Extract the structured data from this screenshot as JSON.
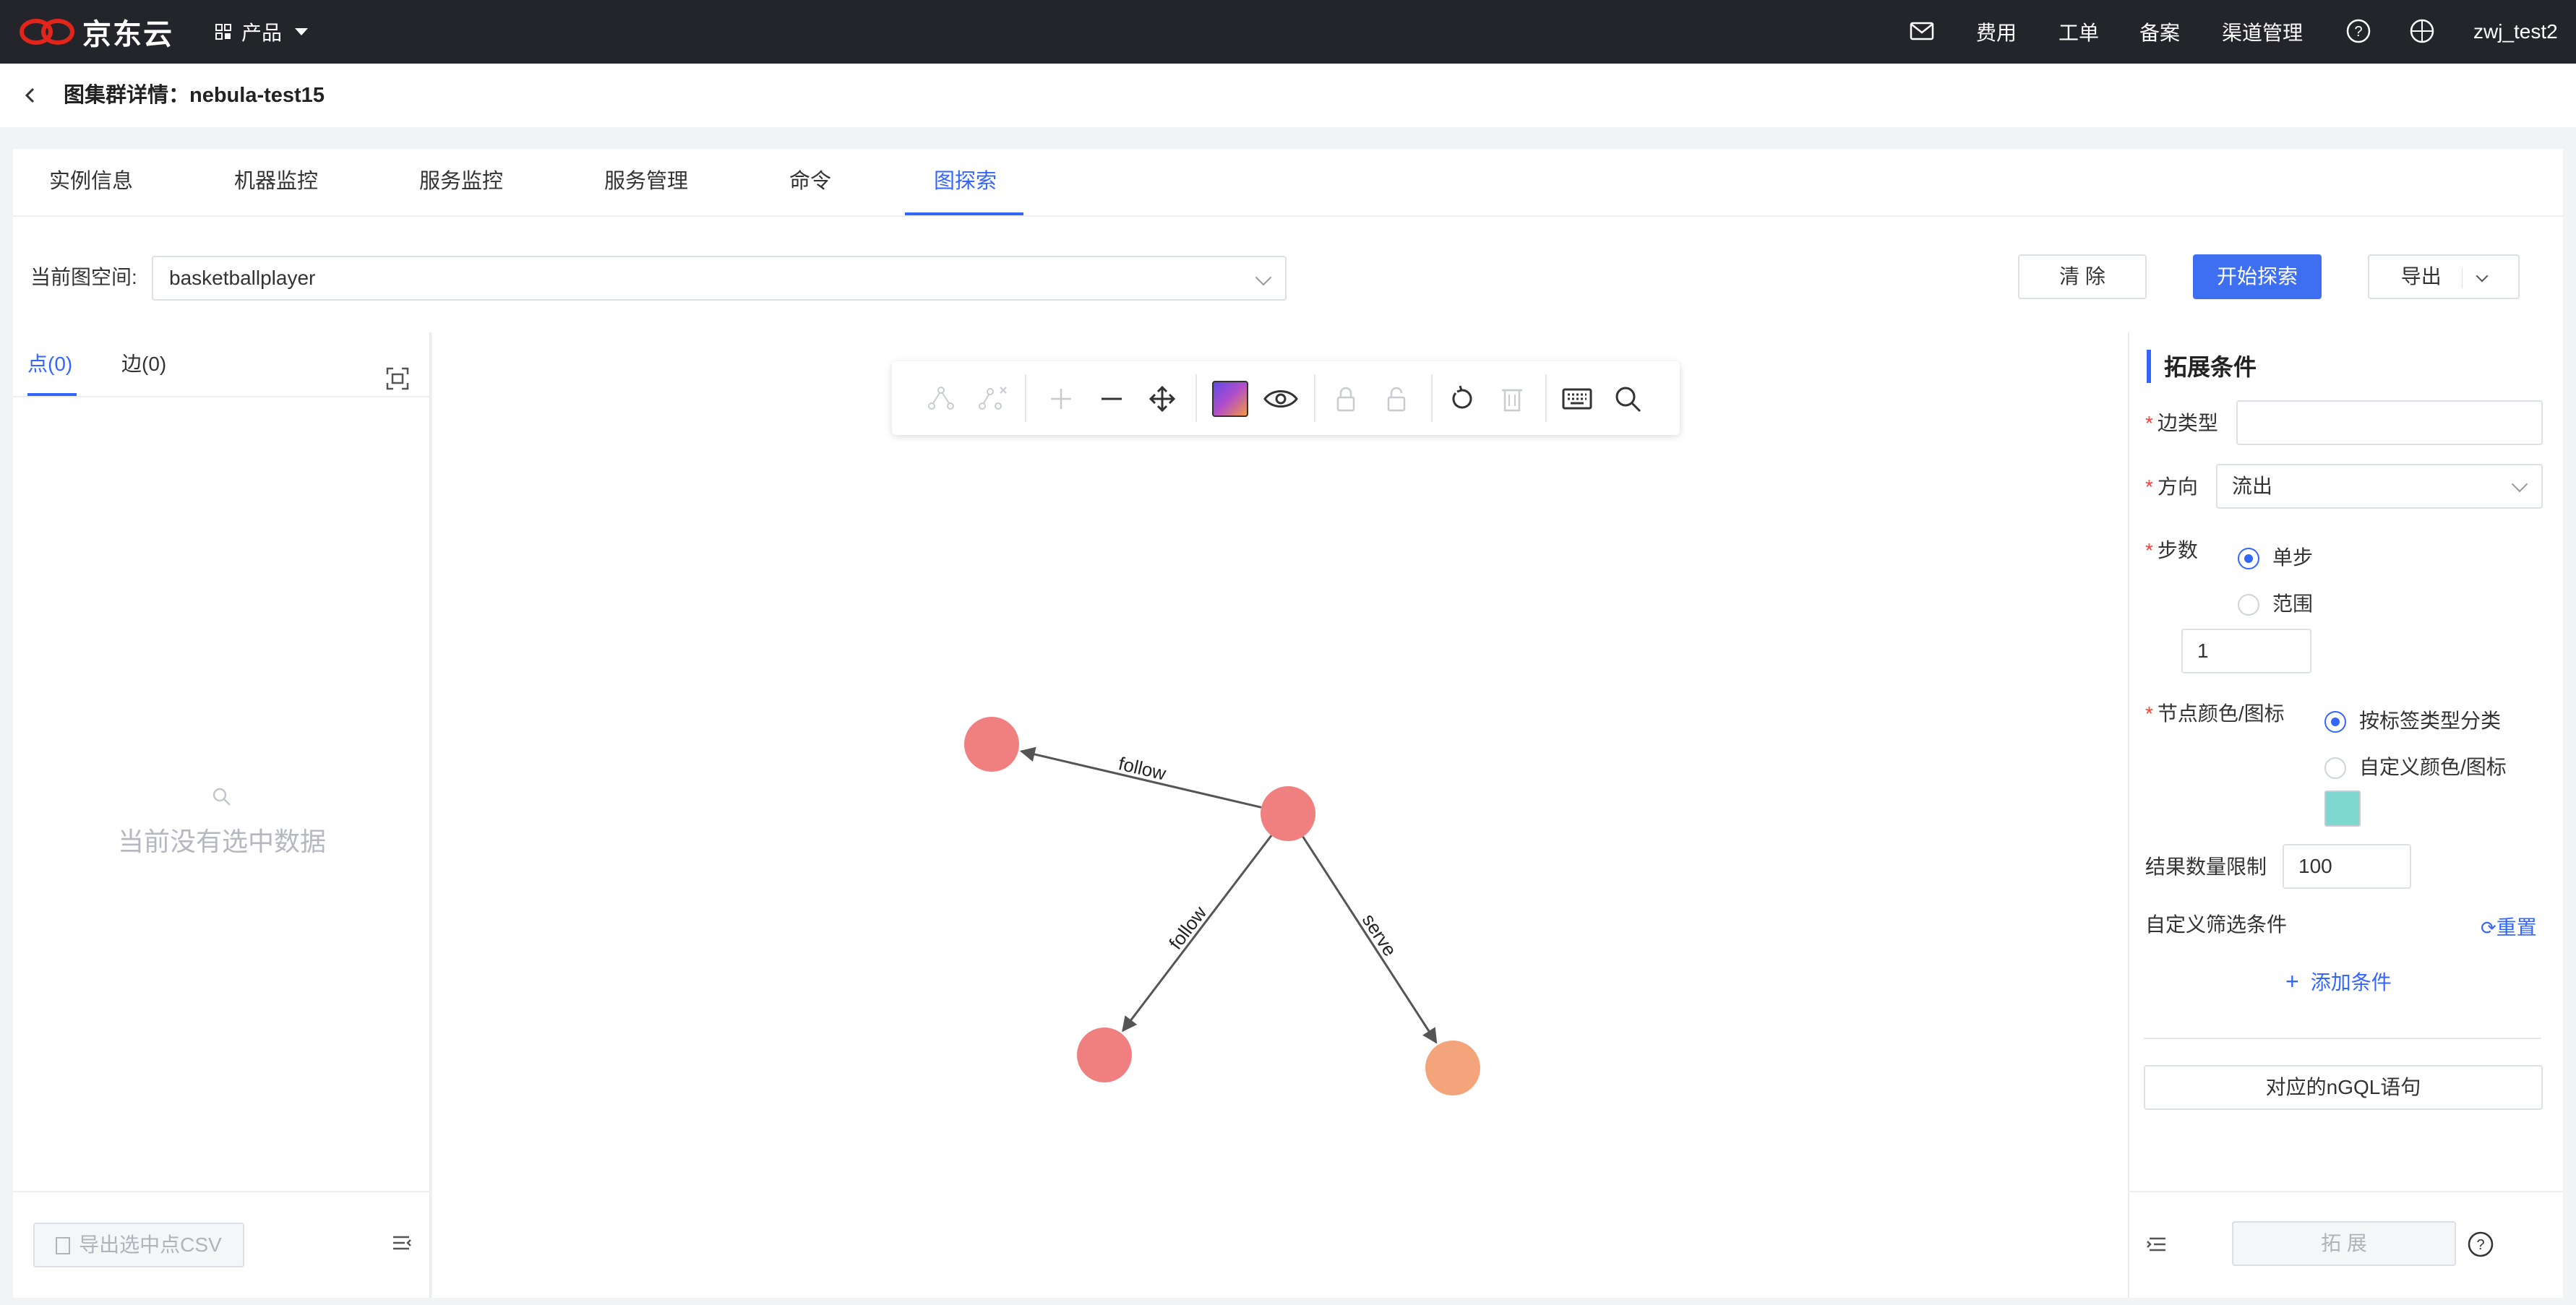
{
  "topbar": {
    "brand": "京东云",
    "product_menu": "产品",
    "nav_items": [
      "费用",
      "工单",
      "备案",
      "渠道管理"
    ],
    "user": "zwj_test2",
    "brand_color": "#e1251b"
  },
  "header": {
    "title": "图集群详情：nebula-test15"
  },
  "tabs": [
    {
      "label": "实例信息",
      "active": false
    },
    {
      "label": "机器监控",
      "active": false
    },
    {
      "label": "服务监控",
      "active": false
    },
    {
      "label": "服务管理",
      "active": false
    },
    {
      "label": "命令",
      "active": false
    },
    {
      "label": "图探索",
      "active": true
    }
  ],
  "space": {
    "label": "当前图空间:",
    "value": "basketballplayer",
    "clear_btn": "清 除",
    "start_btn": "开始探索",
    "export_btn": "导出"
  },
  "left_panel": {
    "tabs": [
      "点(0)",
      "边(0)"
    ],
    "empty_text": "当前没有选中数据",
    "export_csv": "导出选中点CSV"
  },
  "graph": {
    "nodes": [
      {
        "id": "n1",
        "color": "#f08080"
      },
      {
        "id": "n2",
        "color": "#f08080"
      },
      {
        "id": "n3",
        "color": "#f08080"
      },
      {
        "id": "n4",
        "color": "#f4a47a"
      }
    ],
    "edges": [
      {
        "from": "n2",
        "to": "n1",
        "label": "follow"
      },
      {
        "from": "n2",
        "to": "n3",
        "label": "follow"
      },
      {
        "from": "n2",
        "to": "n4",
        "label": "serve"
      }
    ]
  },
  "right_panel": {
    "title": "拓展条件",
    "edge_type_label": "边类型",
    "edge_type_value": "",
    "direction_label": "方向",
    "direction_value": "流出",
    "steps_label": "步数",
    "step_single": "单步",
    "step_range": "范围",
    "steps_value": "1",
    "node_color_label": "节点颜色/图标",
    "color_by_tag": "按标签类型分类",
    "color_custom": "自定义颜色/图标",
    "custom_color": "#7fd8cf",
    "limit_label": "结果数量限制",
    "limit_value": "100",
    "filter_label": "自定义筛选条件",
    "reset": "重置",
    "add_condition": "添加条件",
    "ngql_btn": "对应的nGQL语句",
    "expand_btn": "拓 展"
  }
}
